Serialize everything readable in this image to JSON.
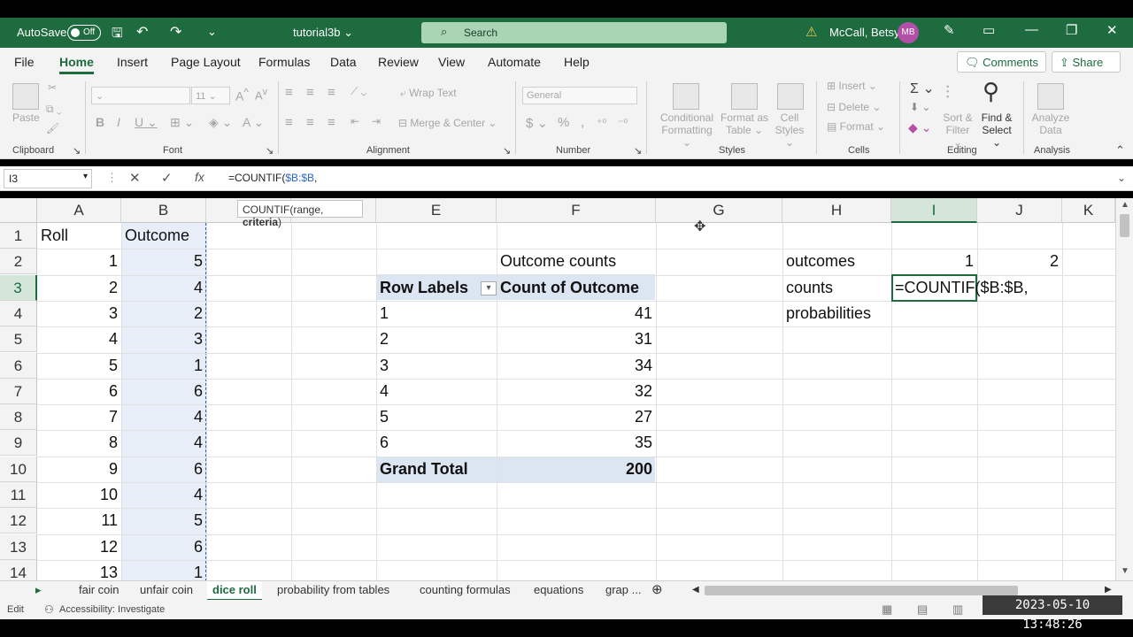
{
  "titlebar": {
    "autosave_label": "AutoSave",
    "autosave_state": "Off",
    "doc_name": "tutorial3b",
    "search_placeholder": "Search",
    "user_name": "McCall, Betsy",
    "user_initials": "MB"
  },
  "tabs": [
    "File",
    "Home",
    "Insert",
    "Page Layout",
    "Formulas",
    "Data",
    "Review",
    "View",
    "Automate",
    "Help"
  ],
  "active_tab": "Home",
  "comments_label": "Comments",
  "share_label": "Share",
  "ribbon": {
    "clipboard": {
      "paste": "Paste",
      "label": "Clipboard"
    },
    "font": {
      "size": "11",
      "label": "Font"
    },
    "alignment": {
      "wrap": "Wrap Text",
      "merge": "Merge & Center",
      "label": "Alignment"
    },
    "number": {
      "format": "General",
      "label": "Number"
    },
    "styles": {
      "conditional": "Conditional",
      "conditional2": "Formatting",
      "format_as": "Format as",
      "format_as2": "Table",
      "cell": "Cell",
      "cell2": "Styles",
      "label": "Styles"
    },
    "cells": {
      "insert": "Insert",
      "delete": "Delete",
      "format": "Format",
      "label": "Cells"
    },
    "editing": {
      "sort": "Sort &",
      "sort2": "Filter",
      "find": "Find &",
      "find2": "Select",
      "label": "Editing"
    },
    "analysis": {
      "analyze": "Analyze",
      "analyze2": "Data",
      "label": "Analysis"
    }
  },
  "formula_bar": {
    "name_box": "I3",
    "formula_prefix": "=COUNTIF(",
    "formula_ref": "$B:$B",
    "formula_suffix": ",",
    "tooltip_prefix": "COUNTIF(range, ",
    "tooltip_bold": "criteria",
    "tooltip_suffix": ")"
  },
  "columns": [
    "A",
    "B",
    "C",
    "D",
    "E",
    "F",
    "G",
    "H",
    "I",
    "J",
    "K"
  ],
  "rows": [
    "1",
    "2",
    "3",
    "4",
    "5",
    "6",
    "7",
    "8",
    "9",
    "10",
    "11",
    "12",
    "13",
    "14"
  ],
  "sheet": {
    "A1": "Roll",
    "B1": "Outcome",
    "rolls": [
      "1",
      "2",
      "3",
      "4",
      "5",
      "6",
      "7",
      "8",
      "9",
      "10",
      "11",
      "12",
      "13"
    ],
    "outcomes": [
      "5",
      "4",
      "2",
      "3",
      "1",
      "6",
      "4",
      "4",
      "6",
      "4",
      "5",
      "6",
      "1"
    ],
    "F2": "Outcome counts",
    "pivot_row_label": "Row Labels",
    "pivot_col_label": "Count of Outcome",
    "pivot_labels": [
      "1",
      "2",
      "3",
      "4",
      "5",
      "6"
    ],
    "pivot_counts": [
      "41",
      "31",
      "34",
      "32",
      "27",
      "35"
    ],
    "grand_total_label": "Grand Total",
    "grand_total": "200",
    "H2": "outcomes",
    "H3": "counts",
    "H4": "probabilities",
    "I2": "1",
    "J2": "2",
    "I3": "=COUNTIF($B:$B,"
  },
  "sheet_tabs": [
    "fair coin",
    "unfair coin",
    "dice roll",
    "probability from tables",
    "counting formulas",
    "equations",
    "grap ..."
  ],
  "active_sheet": "dice roll",
  "status": {
    "mode": "Edit",
    "accessibility": "Accessibility: Investigate"
  },
  "timestamp": "2023-05-10  13:48:26",
  "colors": {
    "accent": "#1d6b3f",
    "selection": "#e7eef8",
    "pivot_header": "#dce6f2"
  }
}
